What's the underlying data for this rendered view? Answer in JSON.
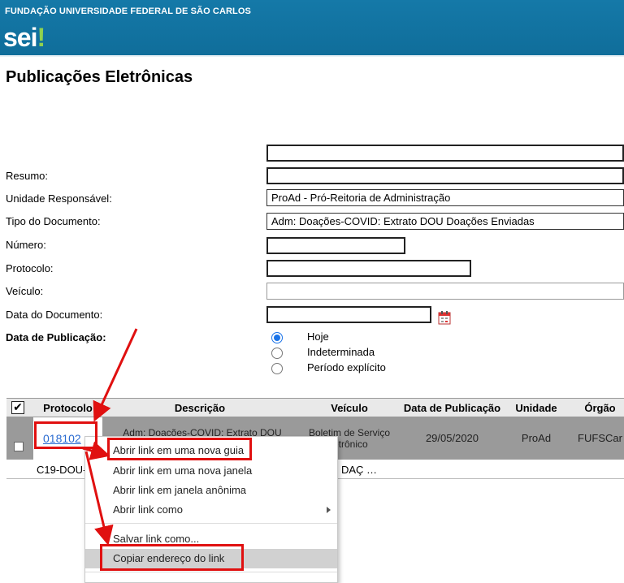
{
  "header": {
    "org_name": "FUNDAÇÃO UNIVERSIDADE FEDERAL DE SÃO CARLOS",
    "logo_text": "sei",
    "logo_accent": "!"
  },
  "page": {
    "title": "Publicações Eletrônicas"
  },
  "form": {
    "resumo_label": "Resumo:",
    "unidade_label": "Unidade Responsável:",
    "unidade_value": "ProAd - Pró-Reitoria de Administração",
    "tipo_label": "Tipo do Documento:",
    "tipo_value": "Adm: Doações-COVID: Extrato DOU Doações Enviadas",
    "numero_label": "Número:",
    "protocolo_label": "Protocolo:",
    "veiculo_label": "Veículo:",
    "data_doc_label": "Data do Documento:",
    "data_pub_label": "Data de Publicação:",
    "radio_options": [
      "Hoje",
      "Indeterminada",
      "Período explícito"
    ],
    "radio_selected": "Hoje"
  },
  "table": {
    "select_all_mark": "✔",
    "headers": [
      "Protocolo",
      "Descrição",
      "Veículo",
      "Data de Publicação",
      "Unidade",
      "Órgão"
    ],
    "row": {
      "protocolo": "018102",
      "descricao": "Adm: Doações-COVID: Extrato DOU",
      "veiculo": "Boletim de Serviço Eletrônico",
      "veiculo_visible": "Boletim de Serviço\nletrônico",
      "data_publicacao": "29/05/2020",
      "unidade": "ProAd",
      "orgao": "FUFSCar",
      "subline_left": "C19-DOU-",
      "subline_right": "DAÇ …"
    }
  },
  "context_menu": {
    "items": [
      "Abrir link em uma nova guia",
      "Abrir link em uma nova janela",
      "Abrir link em janela anônima",
      "Abrir link como",
      "Salvar link como...",
      "Copiar endereço do link"
    ],
    "highlighted": "Copiar endereço do link"
  },
  "colors": {
    "header_blue": "#1579a8",
    "logo_green": "#8fd14f",
    "link_blue": "#2a6bd1",
    "annotation_red": "#e01010",
    "row_gray": "#9a9a9a"
  }
}
